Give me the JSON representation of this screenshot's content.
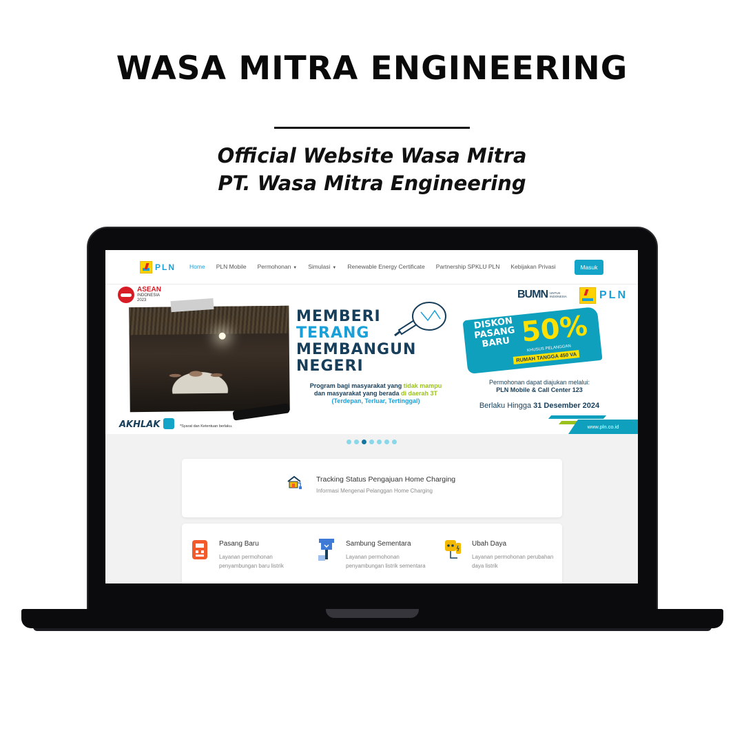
{
  "poster": {
    "title": "WASA MITRA ENGINEERING",
    "subtitle_line1": "Official Website Wasa Mitra",
    "subtitle_line2": "PT. Wasa Mitra Engineering"
  },
  "nav": {
    "logo_text": "PLN",
    "links": [
      "Home",
      "PLN Mobile",
      "Permohonan",
      "Simulasi",
      "Renewable Energy Certificate",
      "Partnership SPKLU PLN",
      "Kebijakan Privasi"
    ],
    "active_index": 0,
    "login_label": "Masuk"
  },
  "banner": {
    "asean_title": "ASEAN",
    "asean_sub": "INDONESIA",
    "asean_year": "2023",
    "headline": [
      "MEMBERI",
      "TERANG",
      "MEMBANGUN",
      "NEGERI"
    ],
    "program_pre": "Program bagi masyarakat yang ",
    "program_hl1": "tidak mampu",
    "program_mid": "dan masyarakat yang berada ",
    "program_hl2": "di daerah 3T",
    "program_line3": "(Terdepan, Terluar, Tertinggal)",
    "bumn": "BUMN",
    "bumn_small1": "UNTUK",
    "bumn_small2": "INDONESIA",
    "pln_right": "PLN",
    "diskon_word": "DISKON PASANG BARU",
    "diskon_pct": "50%",
    "diskon_khusus": "KHUSUS PELANGGAN",
    "diskon_rumah": "RUMAH TANGGA 450 VA",
    "permohonan_line1": "Permohonan dapat diajukan melalui:",
    "permohonan_line2": "PLN Mobile & Call Center 123",
    "berlaku_pre": "Berlaku Hingga ",
    "berlaku_date": "31 Desember 2024",
    "akhlak": "AKHLAK",
    "syarat": "*Syarat dan Ketentuan berlaku.",
    "url": "www.pln.co.id"
  },
  "carousel": {
    "count": 7,
    "active_index": 2
  },
  "tracking": {
    "title": "Tracking Status Pengajuan Home Charging",
    "subtitle": "Informasi Mengenai Pelanggan Home Charging",
    "icon": "house-charging-icon"
  },
  "services": [
    {
      "title": "Pasang Baru",
      "desc": "Layanan permohonan penyambungan baru listrik",
      "icon": "meter-icon",
      "color": "#f25a2c"
    },
    {
      "title": "Sambung Sementara",
      "desc": "Layanan permohonan penyambungan listrik sementara",
      "icon": "tower-plug-icon",
      "color": "#3f7bd6"
    },
    {
      "title": "Ubah Daya",
      "desc": "Layanan permohonan perubahan daya listrik",
      "icon": "socket-icon",
      "color": "#f5b800"
    }
  ],
  "colors": {
    "accent": "#1aa0d8",
    "navy": "#173e5a",
    "button": "#14a4c8",
    "lime": "#9bc21c",
    "yellow": "#ffe100"
  }
}
